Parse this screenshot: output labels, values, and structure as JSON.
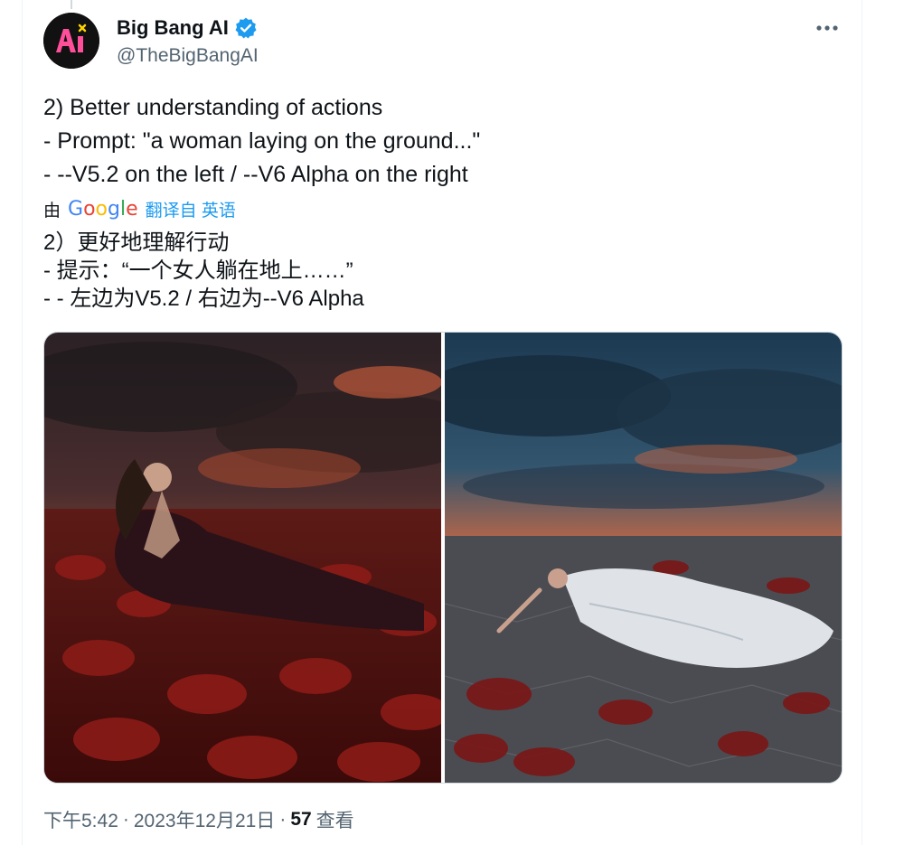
{
  "author": {
    "display_name": "Big Bang AI",
    "handle": "@TheBigBangAI",
    "avatar_text": "AI",
    "verified": true,
    "verified_icon": "verified-badge-icon"
  },
  "tweet": {
    "lines": [
      "2) Better understanding of actions",
      "- Prompt: \"a woman laying on the ground...\"",
      "- --V5.2 on the left / --V6 Alpha on the right"
    ]
  },
  "translation": {
    "by_label": "由",
    "provider": "Google",
    "link_label": "翻译自 英语",
    "lines": [
      "2）更好地理解行动",
      "- 提示：“一个女人躺在地上……”",
      "- - 左边为V5.2 / 右边为--V6 Alpha"
    ]
  },
  "media": {
    "images": [
      {
        "name": "left-image",
        "description_icon": "photo"
      },
      {
        "name": "right-image",
        "description_icon": "photo"
      }
    ]
  },
  "meta": {
    "time": "下午5:42",
    "separator": "·",
    "date": "2023年12月21日",
    "views_count": "57",
    "views_label": "查看"
  },
  "colors": {
    "accent": "#1d9bf0",
    "text": "#0f1419",
    "secondary": "#536471"
  }
}
